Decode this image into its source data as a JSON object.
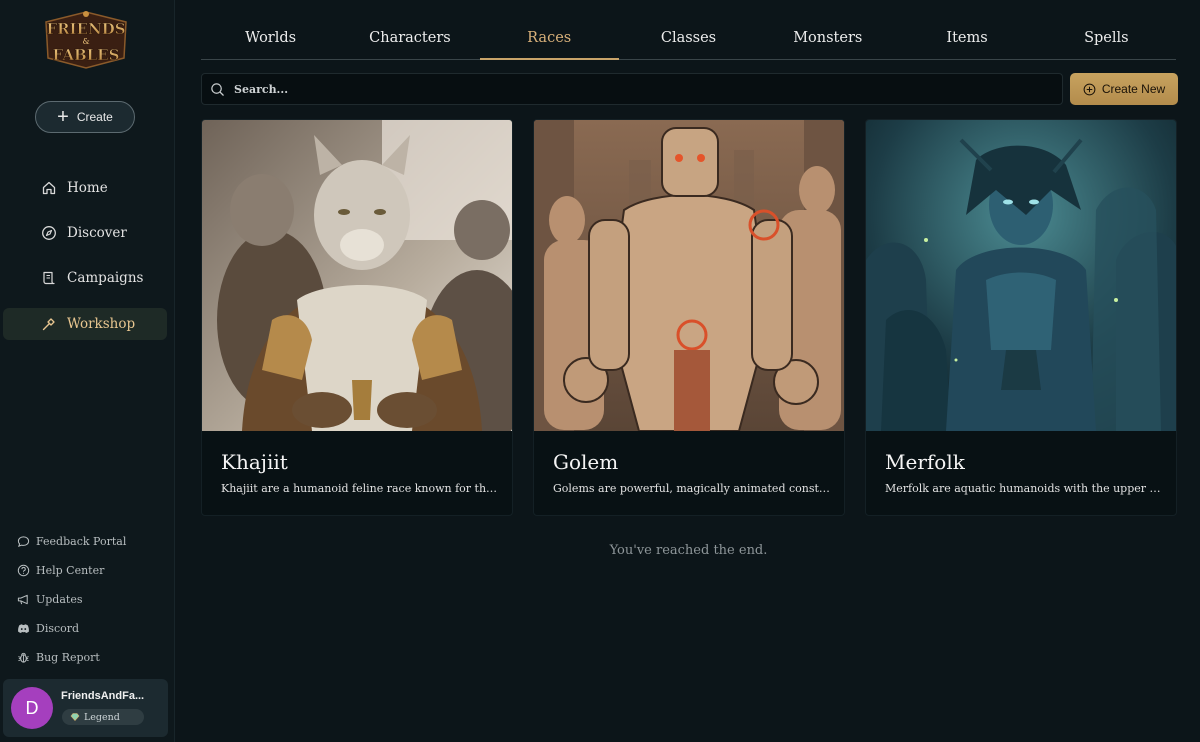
{
  "app": {
    "logo_line1": "FRIENDS",
    "logo_amp": "&",
    "logo_line2": "FABLES"
  },
  "sidebar": {
    "create_label": "Create",
    "nav": [
      {
        "label": "Home",
        "icon": "home-icon"
      },
      {
        "label": "Discover",
        "icon": "compass-icon"
      },
      {
        "label": "Campaigns",
        "icon": "scroll-icon"
      },
      {
        "label": "Workshop",
        "icon": "hammer-icon",
        "active": true
      }
    ],
    "footer": [
      {
        "label": "Feedback Portal",
        "icon": "chat-bubble-icon"
      },
      {
        "label": "Help Center",
        "icon": "help-circle-icon"
      },
      {
        "label": "Updates",
        "icon": "megaphone-icon"
      },
      {
        "label": "Discord",
        "icon": "discord-icon"
      },
      {
        "label": "Bug Report",
        "icon": "bug-icon"
      }
    ],
    "user": {
      "initial": "D",
      "name": "FriendsAndFa...",
      "tier": "Legend"
    }
  },
  "tabs": [
    "Worlds",
    "Characters",
    "Races",
    "Classes",
    "Monsters",
    "Items",
    "Spells"
  ],
  "active_tab": "Races",
  "search": {
    "placeholder": "Search..."
  },
  "create_new_label": "Create New",
  "cards": [
    {
      "title": "Khajiit",
      "description": "Khajiit are a humanoid feline race known for thei..."
    },
    {
      "title": "Golem",
      "description": "Golems are powerful, magically animated constr..."
    },
    {
      "title": "Merfolk",
      "description": "Merfolk are aquatic humanoids with the upper b..."
    }
  ],
  "end_message": "You've reached the end.",
  "colors": {
    "background": "#0c1519",
    "accent_gold": "#c9a46a",
    "active_nav_text": "#e8c690",
    "avatar": "#a53fbe"
  }
}
